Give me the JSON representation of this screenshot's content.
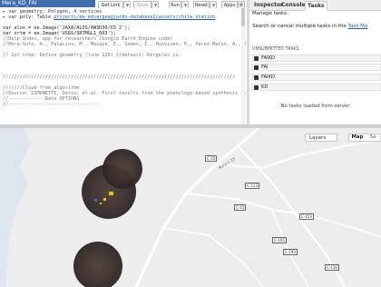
{
  "title_strip": "Mera_KD_FAI",
  "toolbar": {
    "get_link": "Get Link",
    "save": "Save",
    "run": "Run",
    "reset": "Reset",
    "apps": "Apps"
  },
  "code_lines": [
    {
      "type": "decl",
      "text": "▸ var geometry: Polygon, 4 vertices"
    },
    {
      "type": "decl",
      "kw": "var ",
      "name": "poly",
      "rest": ": Table ",
      "link": "projects/ee-edsargeagjardo-database2/assets/chile_station"
    },
    {
      "type": "blank",
      "text": ""
    },
    {
      "type": "code",
      "text": "var alos = ee.Image('JAXA/ALOS/AW3D30/V3_2');"
    },
    {
      "type": "code",
      "text": "var srtm = ee.Image('USGS/SRTMGL1_003');"
    },
    {
      "type": "comment",
      "text": "//Help Index, app for researchers (Google Earth Engine code)"
    },
    {
      "type": "comment",
      "text": "//Mora-Soto, A., Palacios, M., Macaya, E., Gomez, I., Huovinen, P., Perez-Matus, A., Young,"
    },
    {
      "type": "blank",
      "text": ""
    },
    {
      "type": "comment",
      "text": "// 1st step: Define geometry (line 120) //default: Kergeles is."
    },
    {
      "type": "blank",
      "text": ""
    },
    {
      "type": "blank",
      "text": ""
    },
    {
      "type": "blank",
      "text": ""
    },
    {
      "type": "comment",
      "text": "//////////////////////////////////////////////////////////////////////////////////"
    },
    {
      "type": "blank",
      "text": ""
    },
    {
      "type": "comment",
      "text": "///////Cloud-free algorithm"
    },
    {
      "type": "comment",
      "text": "//Source: SIMONETTI, Dario, et al. First results from the phenology-based synthesis classif"
    },
    {
      "type": "comment",
      "text": "//------------ Date OPTIONS"
    },
    {
      "type": "comment",
      "text": "//--------------------------------"
    }
  ],
  "tabs": {
    "inspector": "Inspector",
    "console": "Console",
    "tasks": "Tasks"
  },
  "tasks_panel": {
    "manage": "Manage tasks.",
    "search_prefix": "Search or cancel multiple tasks in the ",
    "search_link": "Task Ma",
    "section_header": "UNSUBMITTED TASKS",
    "tasks": [
      {
        "label": "FAIKD"
      },
      {
        "label": "FAI"
      },
      {
        "label": "FAIKD"
      },
      {
        "label": "KD"
      }
    ],
    "empty_message": "No tasks loaded from server"
  },
  "map": {
    "layers_label": "Layers",
    "map_label": "Map",
    "satellite_label": "Sa",
    "road_label": "Ruta C-15",
    "shields": [
      "C-15",
      "C-113",
      "C-15",
      "C-153",
      "C-105",
      "C-193",
      "C-130"
    ],
    "colors": {
      "land": "#ededed",
      "road": "#ffffff",
      "sea_blue": "#8ab4f8",
      "imagery_dark": "#3a3030"
    }
  }
}
